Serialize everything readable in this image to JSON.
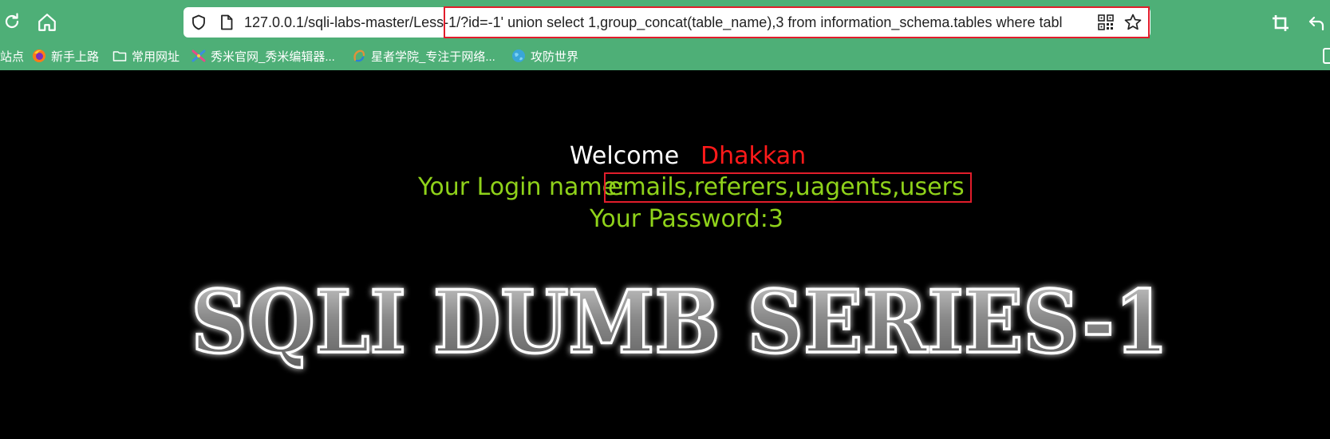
{
  "browser": {
    "url": "127.0.0.1/sqli-labs-master/Less-1/?id=-1' union select 1,group_concat(table_name),3 from information_schema.tables where tabl",
    "bookmarks": [
      {
        "label": "站点",
        "icon": "none"
      },
      {
        "label": "新手上路",
        "icon": "firefox-icon"
      },
      {
        "label": "常用网址",
        "icon": "folder-icon"
      },
      {
        "label": "秀米官网_秀米编辑器...",
        "icon": "xiumi-icon"
      },
      {
        "label": "星者学院_专注于网络...",
        "icon": "xingzhe-icon"
      },
      {
        "label": "攻防世界",
        "icon": "globe-icon"
      }
    ]
  },
  "page": {
    "welcome": "Welcome",
    "user": "Dhakkan",
    "login_label": "Your Login name:",
    "login_value": "emails,referers,uagents,users",
    "password": "Your Password:3",
    "banner": "SQLI DUMB SERIES-1"
  },
  "colors": {
    "toolbar": "#4eaf77",
    "highlight_box": "#e11d2b",
    "user_name": "#ff1a1a",
    "result_text": "#8fd21a"
  }
}
